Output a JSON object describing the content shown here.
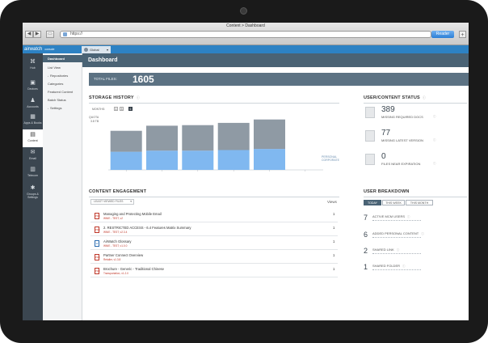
{
  "browser": {
    "window_title": "Content > Dashboard",
    "url": "https://",
    "reader_label": "Reader",
    "back_glyph": "◀",
    "forward_glyph": "▶",
    "plus_glyph": "+"
  },
  "brand": {
    "name": "airwatch",
    "sub": "console"
  },
  "global_tab": {
    "label": "Global",
    "caret": "▾"
  },
  "left_nav": [
    {
      "label": "Hub",
      "icon": "network-icon",
      "glyph": "⌘"
    },
    {
      "label": "Devices",
      "icon": "devices-icon",
      "glyph": "▣"
    },
    {
      "label": "Accounts",
      "icon": "accounts-icon",
      "glyph": "♟"
    },
    {
      "label": "Apps & Books",
      "icon": "apps-icon",
      "glyph": "▦"
    },
    {
      "label": "Content",
      "icon": "content-icon",
      "glyph": "▤"
    },
    {
      "label": "Email",
      "icon": "email-icon",
      "glyph": "✉"
    },
    {
      "label": "Telecom",
      "icon": "telecom-icon",
      "glyph": "▥"
    },
    {
      "label": "Groups & Settings",
      "icon": "settings-icon",
      "glyph": "✱"
    }
  ],
  "sub_nav": [
    {
      "label": "Dashboard",
      "arrow": ""
    },
    {
      "label": "List View",
      "arrow": ""
    },
    {
      "label": "Repositories",
      "arrow": "›"
    },
    {
      "label": "Categories",
      "arrow": ""
    },
    {
      "label": "Featured Content",
      "arrow": ""
    },
    {
      "label": "Batch Status",
      "arrow": ""
    },
    {
      "label": "Settings",
      "arrow": "›"
    }
  ],
  "header": {
    "title": "Dashboard"
  },
  "total_files": {
    "label": "TOTAL FILES:",
    "value": "1605"
  },
  "storage_history": {
    "title": "STORAGE HISTORY",
    "months_label": "MONTHS:",
    "month_options": [
      "1",
      "3",
      "6"
    ],
    "quota_label": "QUOTA",
    "quota_value": "3.8 TB",
    "legend_label": "PERSONAL CORPORATE",
    "info_glyph": "ⓘ"
  },
  "chart_data": {
    "type": "bar",
    "stacked": true,
    "categories": [
      "",
      "",
      "",
      "",
      "",
      ""
    ],
    "series": [
      {
        "values": [
          0.32,
          0.34,
          0.34,
          0.35,
          0.37,
          0
        ],
        "color": "#80b8f0"
      },
      {
        "values": [
          0.37,
          0.44,
          0.45,
          0.48,
          0.52,
          0
        ],
        "color": "#8f9aa4"
      }
    ],
    "ylim": [
      0,
      1
    ]
  },
  "user_content_status": {
    "title": "USER/CONTENT STATUS",
    "info_glyph": "ⓘ",
    "rows": [
      {
        "value": "389",
        "label": "MISSING REQUIRED DOCS"
      },
      {
        "value": "77",
        "label": "MISSING LATEST VERSION"
      },
      {
        "value": "0",
        "label": "FILES NEAR EXPIRATION"
      }
    ]
  },
  "content_engagement": {
    "title": "CONTENT ENGAGEMENT",
    "dropdown_label": "LEAST VIEWED FILES",
    "dropdown_caret": "▾",
    "views_header": "Views",
    "rows": [
      {
        "title": "Managing and Protecting Mobile Email",
        "meta": "WNIE - TEST, v2",
        "views": "1",
        "type": "PDF"
      },
      {
        "title": "2. RESTRICTED ACCESS - 6.4 Features Matrix Summary",
        "meta": "WNIE - TEST, v2.3.4",
        "views": "1",
        "type": "PDF"
      },
      {
        "title": "AirWatch Glossary",
        "meta": "WNIE - TEST, v1.0.0",
        "views": "1",
        "type": "W"
      },
      {
        "title": "Partner Connect Overview",
        "meta": "Retailer, v1.3.8",
        "views": "1",
        "type": "PDF"
      },
      {
        "title": "Brochure - Generic - Traditional Chinese",
        "meta": "Transportation, v1.2.0",
        "views": "1",
        "type": "PDF"
      }
    ]
  },
  "user_breakdown": {
    "title": "USER BREAKDOWN",
    "tabs": [
      "TODAY",
      "THIS WEEK",
      "THIS MONTH"
    ],
    "info_glyph": "ⓘ",
    "rows": [
      {
        "value": "7",
        "label": "ACTIVE MCM USERS"
      },
      {
        "value": "6",
        "label": "ADDED PERSONAL CONTENT"
      },
      {
        "value": "2",
        "label": "SHARED LINK"
      },
      {
        "value": "1",
        "label": "SHARED FOLDER"
      }
    ]
  }
}
